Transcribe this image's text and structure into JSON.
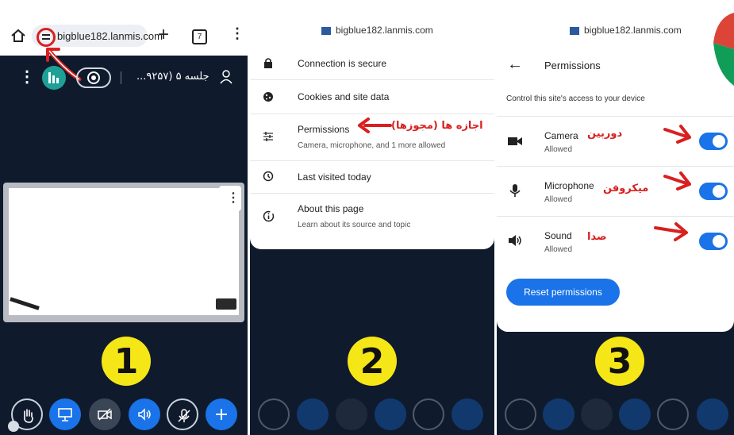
{
  "panel1": {
    "url": "bigblue182.lanmis.com",
    "tab_count": "7",
    "session_title": "جلسه ۵ (۹۲۵۷...",
    "step_number": "1"
  },
  "panel2": {
    "site": "bigblue182.lanmis.com",
    "items": [
      {
        "label": "Connection is secure",
        "sub": ""
      },
      {
        "label": "Cookies and site data",
        "sub": ""
      },
      {
        "label": "Permissions",
        "sub": "Camera, microphone, and 1 more allowed"
      },
      {
        "label": "Last visited today",
        "sub": ""
      },
      {
        "label": "About this page",
        "sub": "Learn about its source and topic"
      }
    ],
    "annotation": "اجازه ها (مجوزها)",
    "step_number": "2"
  },
  "panel3": {
    "site": "bigblue182.lanmis.com",
    "title": "Permissions",
    "description": "Control this site's access to your device",
    "perms": [
      {
        "label": "Camera",
        "status": "Allowed",
        "annotation": "دوربین",
        "enabled": true
      },
      {
        "label": "Microphone",
        "status": "Allowed",
        "annotation": "میکروفن",
        "enabled": true
      },
      {
        "label": "Sound",
        "status": "Allowed",
        "annotation": "صدا",
        "enabled": true
      }
    ],
    "reset_label": "Reset permissions",
    "step_number": "3"
  },
  "colors": {
    "navy": "#0f1b2d",
    "accent_blue": "#1a73e8",
    "annotation_red": "#d8201f",
    "badge_yellow": "#f5e617"
  }
}
